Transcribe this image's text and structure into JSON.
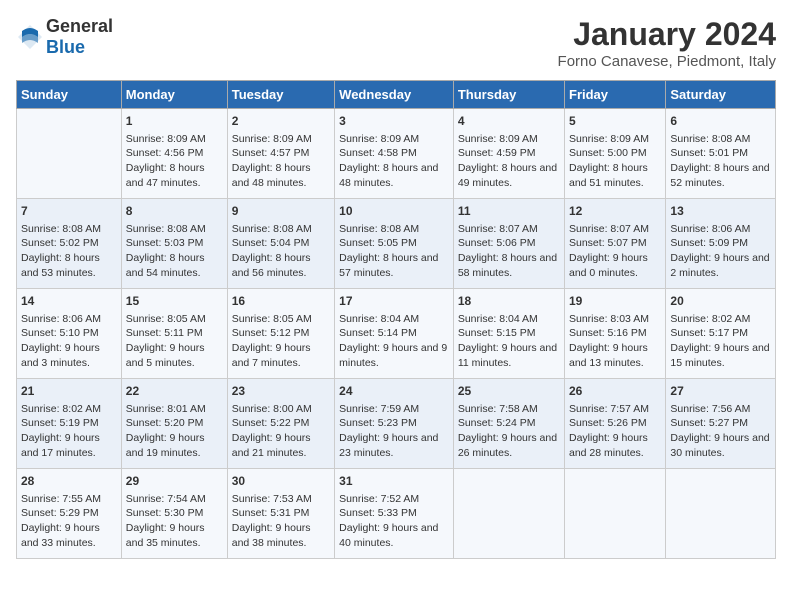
{
  "header": {
    "logo_general": "General",
    "logo_blue": "Blue",
    "month": "January 2024",
    "location": "Forno Canavese, Piedmont, Italy"
  },
  "weekdays": [
    "Sunday",
    "Monday",
    "Tuesday",
    "Wednesday",
    "Thursday",
    "Friday",
    "Saturday"
  ],
  "weeks": [
    [
      {
        "day": "",
        "sunrise": "",
        "sunset": "",
        "daylight": ""
      },
      {
        "day": "1",
        "sunrise": "Sunrise: 8:09 AM",
        "sunset": "Sunset: 4:56 PM",
        "daylight": "Daylight: 8 hours and 47 minutes."
      },
      {
        "day": "2",
        "sunrise": "Sunrise: 8:09 AM",
        "sunset": "Sunset: 4:57 PM",
        "daylight": "Daylight: 8 hours and 48 minutes."
      },
      {
        "day": "3",
        "sunrise": "Sunrise: 8:09 AM",
        "sunset": "Sunset: 4:58 PM",
        "daylight": "Daylight: 8 hours and 48 minutes."
      },
      {
        "day": "4",
        "sunrise": "Sunrise: 8:09 AM",
        "sunset": "Sunset: 4:59 PM",
        "daylight": "Daylight: 8 hours and 49 minutes."
      },
      {
        "day": "5",
        "sunrise": "Sunrise: 8:09 AM",
        "sunset": "Sunset: 5:00 PM",
        "daylight": "Daylight: 8 hours and 51 minutes."
      },
      {
        "day": "6",
        "sunrise": "Sunrise: 8:08 AM",
        "sunset": "Sunset: 5:01 PM",
        "daylight": "Daylight: 8 hours and 52 minutes."
      }
    ],
    [
      {
        "day": "7",
        "sunrise": "Sunrise: 8:08 AM",
        "sunset": "Sunset: 5:02 PM",
        "daylight": "Daylight: 8 hours and 53 minutes."
      },
      {
        "day": "8",
        "sunrise": "Sunrise: 8:08 AM",
        "sunset": "Sunset: 5:03 PM",
        "daylight": "Daylight: 8 hours and 54 minutes."
      },
      {
        "day": "9",
        "sunrise": "Sunrise: 8:08 AM",
        "sunset": "Sunset: 5:04 PM",
        "daylight": "Daylight: 8 hours and 56 minutes."
      },
      {
        "day": "10",
        "sunrise": "Sunrise: 8:08 AM",
        "sunset": "Sunset: 5:05 PM",
        "daylight": "Daylight: 8 hours and 57 minutes."
      },
      {
        "day": "11",
        "sunrise": "Sunrise: 8:07 AM",
        "sunset": "Sunset: 5:06 PM",
        "daylight": "Daylight: 8 hours and 58 minutes."
      },
      {
        "day": "12",
        "sunrise": "Sunrise: 8:07 AM",
        "sunset": "Sunset: 5:07 PM",
        "daylight": "Daylight: 9 hours and 0 minutes."
      },
      {
        "day": "13",
        "sunrise": "Sunrise: 8:06 AM",
        "sunset": "Sunset: 5:09 PM",
        "daylight": "Daylight: 9 hours and 2 minutes."
      }
    ],
    [
      {
        "day": "14",
        "sunrise": "Sunrise: 8:06 AM",
        "sunset": "Sunset: 5:10 PM",
        "daylight": "Daylight: 9 hours and 3 minutes."
      },
      {
        "day": "15",
        "sunrise": "Sunrise: 8:05 AM",
        "sunset": "Sunset: 5:11 PM",
        "daylight": "Daylight: 9 hours and 5 minutes."
      },
      {
        "day": "16",
        "sunrise": "Sunrise: 8:05 AM",
        "sunset": "Sunset: 5:12 PM",
        "daylight": "Daylight: 9 hours and 7 minutes."
      },
      {
        "day": "17",
        "sunrise": "Sunrise: 8:04 AM",
        "sunset": "Sunset: 5:14 PM",
        "daylight": "Daylight: 9 hours and 9 minutes."
      },
      {
        "day": "18",
        "sunrise": "Sunrise: 8:04 AM",
        "sunset": "Sunset: 5:15 PM",
        "daylight": "Daylight: 9 hours and 11 minutes."
      },
      {
        "day": "19",
        "sunrise": "Sunrise: 8:03 AM",
        "sunset": "Sunset: 5:16 PM",
        "daylight": "Daylight: 9 hours and 13 minutes."
      },
      {
        "day": "20",
        "sunrise": "Sunrise: 8:02 AM",
        "sunset": "Sunset: 5:17 PM",
        "daylight": "Daylight: 9 hours and 15 minutes."
      }
    ],
    [
      {
        "day": "21",
        "sunrise": "Sunrise: 8:02 AM",
        "sunset": "Sunset: 5:19 PM",
        "daylight": "Daylight: 9 hours and 17 minutes."
      },
      {
        "day": "22",
        "sunrise": "Sunrise: 8:01 AM",
        "sunset": "Sunset: 5:20 PM",
        "daylight": "Daylight: 9 hours and 19 minutes."
      },
      {
        "day": "23",
        "sunrise": "Sunrise: 8:00 AM",
        "sunset": "Sunset: 5:22 PM",
        "daylight": "Daylight: 9 hours and 21 minutes."
      },
      {
        "day": "24",
        "sunrise": "Sunrise: 7:59 AM",
        "sunset": "Sunset: 5:23 PM",
        "daylight": "Daylight: 9 hours and 23 minutes."
      },
      {
        "day": "25",
        "sunrise": "Sunrise: 7:58 AM",
        "sunset": "Sunset: 5:24 PM",
        "daylight": "Daylight: 9 hours and 26 minutes."
      },
      {
        "day": "26",
        "sunrise": "Sunrise: 7:57 AM",
        "sunset": "Sunset: 5:26 PM",
        "daylight": "Daylight: 9 hours and 28 minutes."
      },
      {
        "day": "27",
        "sunrise": "Sunrise: 7:56 AM",
        "sunset": "Sunset: 5:27 PM",
        "daylight": "Daylight: 9 hours and 30 minutes."
      }
    ],
    [
      {
        "day": "28",
        "sunrise": "Sunrise: 7:55 AM",
        "sunset": "Sunset: 5:29 PM",
        "daylight": "Daylight: 9 hours and 33 minutes."
      },
      {
        "day": "29",
        "sunrise": "Sunrise: 7:54 AM",
        "sunset": "Sunset: 5:30 PM",
        "daylight": "Daylight: 9 hours and 35 minutes."
      },
      {
        "day": "30",
        "sunrise": "Sunrise: 7:53 AM",
        "sunset": "Sunset: 5:31 PM",
        "daylight": "Daylight: 9 hours and 38 minutes."
      },
      {
        "day": "31",
        "sunrise": "Sunrise: 7:52 AM",
        "sunset": "Sunset: 5:33 PM",
        "daylight": "Daylight: 9 hours and 40 minutes."
      },
      {
        "day": "",
        "sunrise": "",
        "sunset": "",
        "daylight": ""
      },
      {
        "day": "",
        "sunrise": "",
        "sunset": "",
        "daylight": ""
      },
      {
        "day": "",
        "sunrise": "",
        "sunset": "",
        "daylight": ""
      }
    ]
  ]
}
